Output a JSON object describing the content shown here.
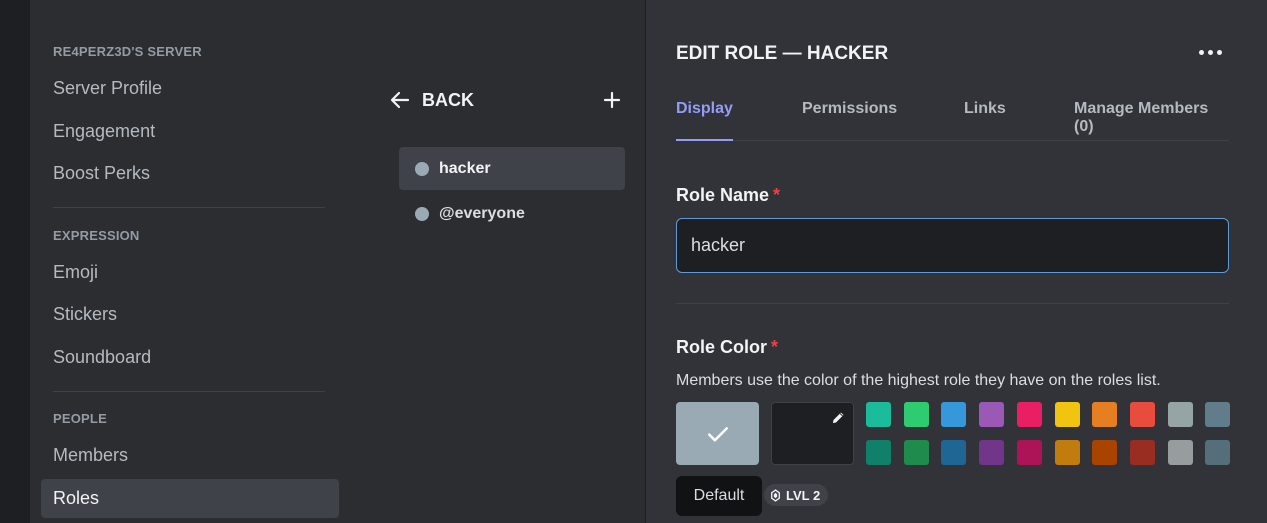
{
  "sidebar": {
    "server_header": "RE4PERZ3D'S SERVER",
    "server_items": [
      {
        "label": "Server Profile"
      },
      {
        "label": "Engagement"
      },
      {
        "label": "Boost Perks"
      }
    ],
    "expression_header": "EXPRESSION",
    "expression_items": [
      {
        "label": "Emoji"
      },
      {
        "label": "Stickers"
      },
      {
        "label": "Soundboard"
      }
    ],
    "people_header": "PEOPLE",
    "people_items": [
      {
        "label": "Members"
      },
      {
        "label": "Roles",
        "active": true
      }
    ]
  },
  "roles_panel": {
    "back_label": "BACK",
    "add_icon": "plus-icon",
    "roles": [
      {
        "name": "hacker",
        "selected": true,
        "color": "#99aab5"
      },
      {
        "name": "@everyone",
        "selected": false,
        "color": "#99aab5"
      }
    ]
  },
  "editor": {
    "title": "EDIT ROLE — HACKER",
    "more_icon": "more-dots-icon",
    "tabs": [
      {
        "label": "Display",
        "active": true
      },
      {
        "label": "Permissions"
      },
      {
        "label": "Links"
      },
      {
        "label": "Manage Members (0)"
      }
    ],
    "role_name_label": "Role Name",
    "required_marker": "*",
    "role_name_value": "hacker",
    "role_color_label": "Role Color",
    "role_color_description": "Members use the color of the highest role they have on the roles list.",
    "default_color": "#99aab5",
    "palette_row1": [
      "#1abc9c",
      "#2ecc71",
      "#3498db",
      "#9b59b6",
      "#e91e63",
      "#f1c40f",
      "#e67e22",
      "#e74c3c",
      "#95a5a6",
      "#607d8b"
    ],
    "palette_row2": [
      "#11806a",
      "#1f8b4c",
      "#206694",
      "#71368a",
      "#ad1457",
      "#c27c0e",
      "#a84300",
      "#992d22",
      "#979c9f",
      "#546e7a"
    ],
    "tooltip": "Default",
    "level_badge": "LVL 2"
  },
  "colors": {
    "accent": "#949cf7",
    "input_focus": "#5e9bd8",
    "required": "#f23f43"
  }
}
